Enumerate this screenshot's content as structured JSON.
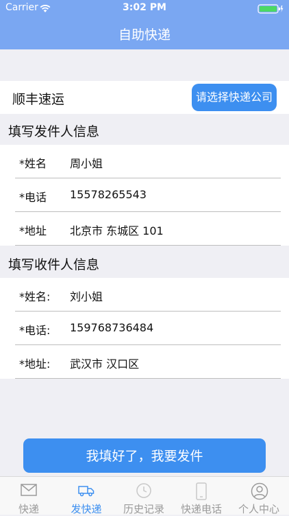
{
  "status_bar": {
    "carrier": "Carrier",
    "time": "3:02 PM"
  },
  "nav": {
    "title": "自助快递"
  },
  "company": {
    "name": "顺丰速运",
    "choose_label": "请选择快递公司"
  },
  "sender": {
    "title": "填写发件人信息",
    "fields": [
      {
        "label": "*姓名",
        "value": "周小姐"
      },
      {
        "label": "*电话",
        "value": "15578265543"
      },
      {
        "label": "*地址",
        "value": "北京市 东城区 101"
      }
    ]
  },
  "receiver": {
    "title": "填写收件人信息",
    "fields": [
      {
        "label": "*姓名:",
        "value": "刘小姐"
      },
      {
        "label": "*电话:",
        "value": "159768736484"
      },
      {
        "label": "*地址:",
        "value": "武汉市 汉口区"
      }
    ]
  },
  "submit_label": "我填好了，我要发件",
  "tabs": [
    {
      "label": "快递",
      "icon": "mail-icon"
    },
    {
      "label": "发快递",
      "icon": "truck-icon",
      "active": true
    },
    {
      "label": "历史记录",
      "icon": "clock-icon"
    },
    {
      "label": "快递电话",
      "icon": "phone-icon"
    },
    {
      "label": "个人中心",
      "icon": "user-icon"
    }
  ],
  "colors": {
    "header": "#7aa7f2",
    "accent": "#3d8ff0",
    "background": "#efeff4"
  }
}
